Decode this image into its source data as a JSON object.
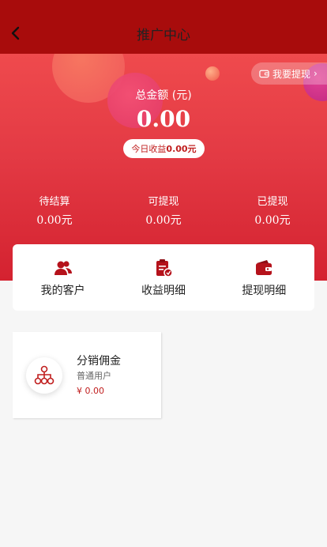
{
  "header": {
    "title": "推广中心",
    "back_icon": "chevron-left-icon"
  },
  "hero": {
    "withdraw_button_label": "我要提现",
    "total_label": "总金额 (元)",
    "total_amount": "0.00",
    "today_label": "今日收益",
    "today_value": "0.00元",
    "stats": [
      {
        "label": "待结算",
        "value": "0.00元"
      },
      {
        "label": "可提现",
        "value": "0.00元"
      },
      {
        "label": "已提现",
        "value": "0.00元"
      }
    ]
  },
  "menu": {
    "items": [
      {
        "label": "我的客户",
        "icon": "users-icon"
      },
      {
        "label": "收益明细",
        "icon": "clipboard-icon"
      },
      {
        "label": "提现明细",
        "icon": "wallet-icon"
      }
    ]
  },
  "commission": {
    "title": "分销佣金",
    "subtitle": "普通用户",
    "value": "¥ 0.00",
    "icon": "hierarchy-icon"
  },
  "colors": {
    "header_bg": "#a80c0c",
    "accent": "#c01e1e",
    "page_bg": "#f6f6f6"
  }
}
